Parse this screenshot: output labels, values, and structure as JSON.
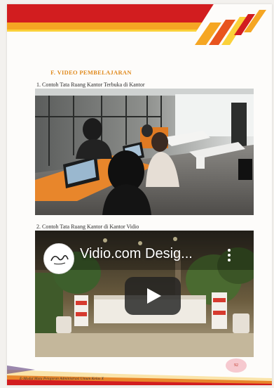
{
  "section": {
    "title": "F. VIDEO PEMBELAJARAN"
  },
  "items": [
    {
      "caption": "1. Contoh Tata Ruang Kantor Terbuka di Kantor"
    },
    {
      "caption": "2. Contoh Tata Ruang Kantor di Kantor Vidio"
    }
  ],
  "video": {
    "title": "Vidio.com Desig...",
    "logo_icon": "channel-logo-icon",
    "play_icon": "play-icon",
    "menu_icon": "kebab-menu-icon"
  },
  "footer": {
    "text": "E-Modul Mata Pelajaran Administrasi Umum Kelas X",
    "page_number": "92"
  },
  "colors": {
    "header_red": "#d21d1f",
    "header_orange": "#f5a623",
    "title_orange": "#e08a1e",
    "youtube_play_bg": "#212121"
  }
}
